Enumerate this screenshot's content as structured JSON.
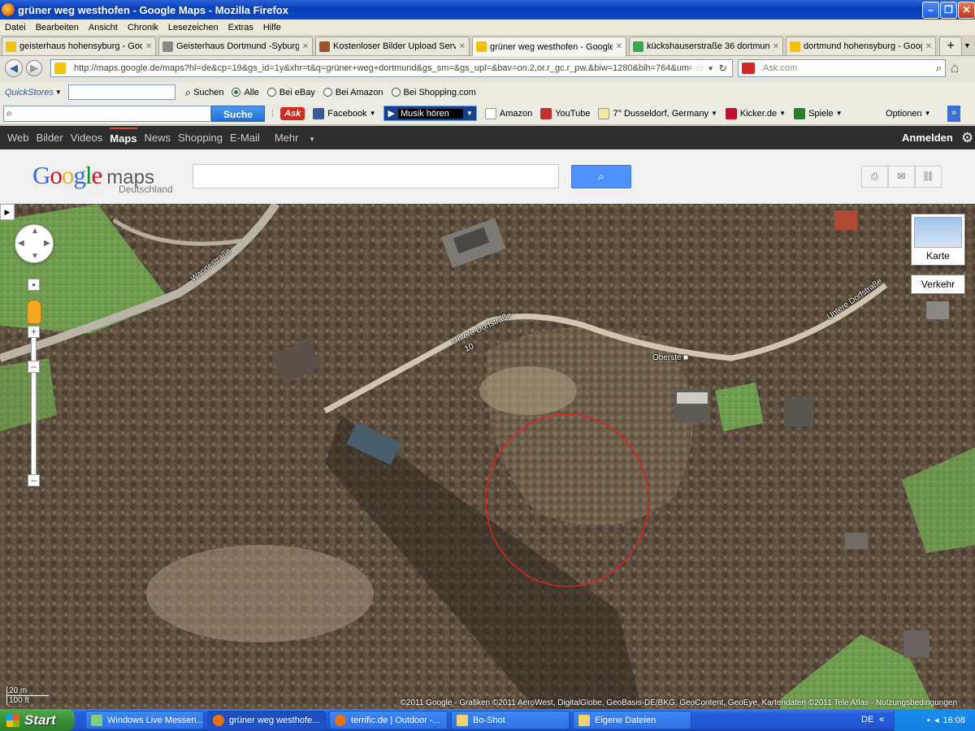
{
  "window": {
    "title": "grüner weg westhofen - Google Maps - Mozilla Firefox",
    "minimize": "–",
    "maximize": "❐",
    "close": "✕"
  },
  "menu": [
    "Datei",
    "Bearbeiten",
    "Ansicht",
    "Chronik",
    "Lesezeichen",
    "Extras",
    "Hilfe"
  ],
  "tabs": [
    {
      "label": "geisterhaus hohensyburg - Goo...",
      "favicon_color": "#f4c20d",
      "active": false
    },
    {
      "label": "Geisterhaus Dortmund -Syburg ...",
      "favicon_color": "#888888",
      "active": false
    },
    {
      "label": "Kostenloser Bilder Upload Servic...",
      "favicon_color": "#a0522d",
      "active": false
    },
    {
      "label": "grüner weg westhofen - Google...",
      "favicon_color": "#f4c20d",
      "active": true
    },
    {
      "label": "kückshauserstraße 36 dortmun...",
      "favicon_color": "#34a853",
      "active": false
    },
    {
      "label": "dortmund hohensyburg - Googl...",
      "favicon_color": "#f4c20d",
      "active": false
    }
  ],
  "nav": {
    "url": "http://maps.google.de/maps?hl=de&cp=19&gs_id=1y&xhr=t&q=grüner+weg+dortmund&gs_sm=&gs_upl=&bav=on.2,or.r_gc.r_pw.&biw=1280&bih=764&um=1&ie=",
    "ask_placeholder": "Ask.com"
  },
  "quickstores": {
    "label": "QuickStores",
    "search_label": "Suchen",
    "options": [
      {
        "label": "Alle",
        "checked": true
      },
      {
        "label": "Bei eBay",
        "checked": false
      },
      {
        "label": "Bei Amazon",
        "checked": false
      },
      {
        "label": "Bei Shopping.com",
        "checked": false
      }
    ]
  },
  "asktoolbar": {
    "search_button": "Suche",
    "ask_logo": "Ask",
    "facebook": "Facebook",
    "music": "Musik hören",
    "amazon": "Amazon",
    "youtube": "YouTube",
    "weather": "7° Dusseldorf, Germany",
    "kicker": "Kicker.de",
    "spiele": "Spiele",
    "optionen": "Optionen"
  },
  "gbar": {
    "items": [
      "Web",
      "Bilder",
      "Videos",
      "Maps",
      "News",
      "Shopping",
      "E-Mail",
      "Mehr"
    ],
    "selected": "Maps",
    "signin": "Anmelden"
  },
  "header": {
    "logo": "Google",
    "logo_maps": "maps",
    "logo_sub": "Deutschland",
    "search_value": ""
  },
  "map": {
    "street_labels": [
      "Wannestraße",
      "Untere Dorfstraße",
      "10",
      "Untere Dorfstraße",
      "Oberste"
    ],
    "map_type_button": "Karte",
    "traffic_button": "Verkehr",
    "copyright": "©2011 Google - Grafiken ©2011 AeroWest, DigitalGlobe, GeoBasis-DE/BKG, GeoContent, GeoEye, Kartendaten ©2011 Tele Atlas - Nutzungsbedingungen",
    "scale_metric": "20 m",
    "scale_imperial": "100 ft",
    "marker_color": "#e0201a"
  },
  "taskbar": {
    "start": "Start",
    "tasks": [
      {
        "label": "Windows Live Messen...",
        "active": false
      },
      {
        "label": "grüner weg westhofe...",
        "active": true
      },
      {
        "label": "terrific.de | Outdoor -...",
        "active": false
      },
      {
        "label": "Bo-Shot",
        "active": false
      },
      {
        "label": "Eigene Dateien",
        "active": false
      }
    ],
    "lang": "DE",
    "clock": "16:08"
  }
}
